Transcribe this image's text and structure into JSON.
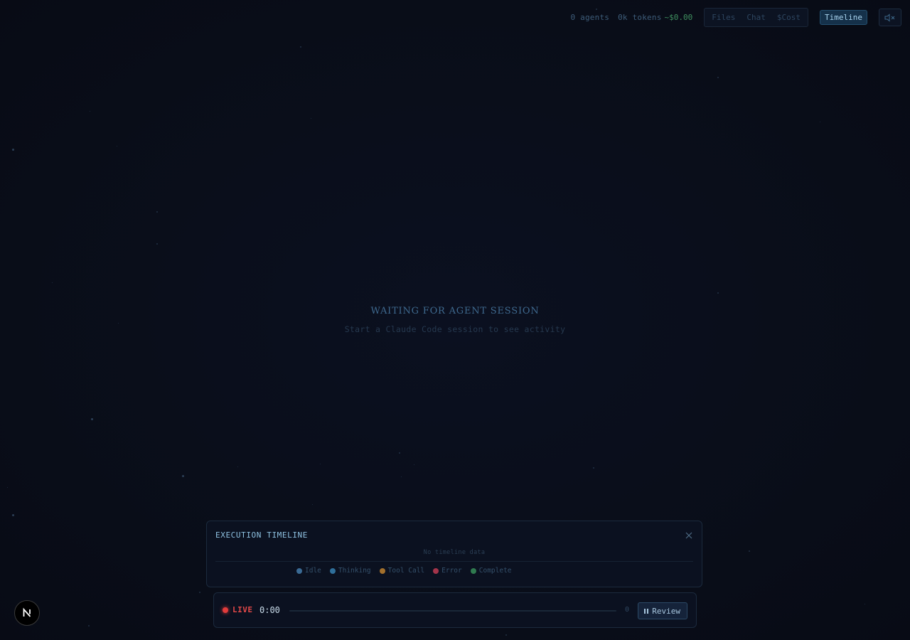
{
  "header": {
    "agents": "0 agents",
    "tokens": "0k tokens",
    "cost": "~$0.00",
    "tabs": [
      "Files",
      "Chat",
      "$Cost"
    ],
    "timeline_label": "Timeline",
    "mute_icon": "speaker-muted-icon"
  },
  "main": {
    "waiting_title": "WAITING FOR AGENT SESSION",
    "waiting_subtitle": "Start a Claude Code session to see activity"
  },
  "timeline_panel": {
    "title": "EXECUTION TIMELINE",
    "empty_text": "No timeline data",
    "legend": [
      {
        "label": "Idle",
        "color": "#3a6a94"
      },
      {
        "label": "Thinking",
        "color": "#2f6f9a"
      },
      {
        "label": "Tool Call",
        "color": "#a3702c"
      },
      {
        "label": "Error",
        "color": "#a3344a"
      },
      {
        "label": "Complete",
        "color": "#2f7a4f"
      }
    ]
  },
  "playback": {
    "live_label": "LIVE",
    "time": "0:00",
    "count": "0",
    "review_label": "Review",
    "progress": 0
  },
  "badge": {
    "letter": "N"
  },
  "colors": {
    "background": "#0a0e1a",
    "accent": "#8fc2e2",
    "live": "#e24848",
    "cost": "#3f8f5f"
  }
}
